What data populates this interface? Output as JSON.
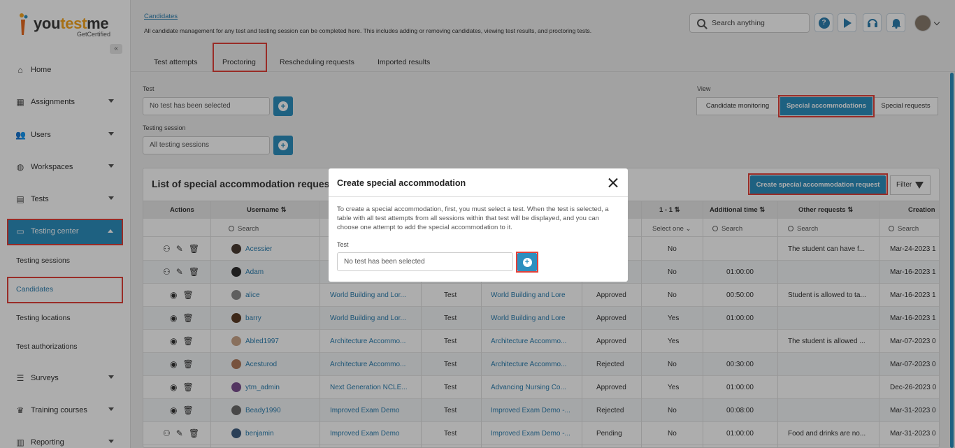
{
  "app": {
    "logo_text_a": "you",
    "logo_text_b": "test",
    "logo_text_c": "me",
    "logo_tagline": "GetCertified"
  },
  "sidebar": {
    "items": [
      {
        "label": "Home",
        "icon": "home-icon"
      },
      {
        "label": "Assignments",
        "icon": "grid-icon"
      },
      {
        "label": "Users",
        "icon": "users-icon"
      },
      {
        "label": "Workspaces",
        "icon": "globe-icon"
      },
      {
        "label": "Tests",
        "icon": "file-icon"
      },
      {
        "label": "Testing center",
        "icon": "monitor-icon"
      },
      {
        "label": "Surveys",
        "icon": "list-icon"
      },
      {
        "label": "Training courses",
        "icon": "trophy-icon"
      },
      {
        "label": "Reporting",
        "icon": "chart-icon"
      }
    ],
    "subitems": [
      "Testing sessions",
      "Candidates",
      "Testing locations",
      "Test authorizations"
    ]
  },
  "header": {
    "breadcrumb": "Candidates",
    "description": "All candidate management for any test and testing session can be completed here. This includes adding or removing candidates, viewing test results, and proctoring tests.",
    "search_placeholder": "Search anything",
    "help": "?"
  },
  "tabs": [
    "Test attempts",
    "Proctoring",
    "Rescheduling requests",
    "Imported results"
  ],
  "filters": {
    "test_label": "Test",
    "test_value": "No test has been selected",
    "session_label": "Testing session",
    "session_value": "All testing sessions",
    "view_label": "View",
    "views": [
      "Candidate monitoring",
      "Special accommodations",
      "Special requests"
    ]
  },
  "panel": {
    "title": "List of special accommodation requests",
    "create_button": "Create special accommodation request",
    "filter_button": "Filter",
    "columns": {
      "actions": "Actions",
      "username": "Username ⇅",
      "one_to_one": "1 - 1 ⇅",
      "additional_time": "Additional time ⇅",
      "other_requests": "Other requests ⇅",
      "creation": "Creation"
    },
    "search": "Search",
    "select_one": "Select one",
    "rows": [
      {
        "user": "Acessier",
        "test": "",
        "type": "",
        "session": "",
        "status": "",
        "one": "No",
        "time": "",
        "other": "The student can have f...",
        "created": "Mar-24-2023 1"
      },
      {
        "user": "Adam",
        "test": "",
        "type": "",
        "session": "",
        "status": "",
        "one": "No",
        "time": "01:00:00",
        "other": "",
        "created": "Mar-16-2023 1"
      },
      {
        "user": "alice",
        "test": "World Building and Lor...",
        "type": "Test",
        "session": "World Building and Lore",
        "status": "Approved",
        "one": "No",
        "time": "00:50:00",
        "other": "Student is allowed to ta...",
        "created": "Mar-16-2023 1"
      },
      {
        "user": "barry",
        "test": "World Building and Lor...",
        "type": "Test",
        "session": "World Building and Lore",
        "status": "Approved",
        "one": "Yes",
        "time": "01:00:00",
        "other": "",
        "created": "Mar-16-2023 1"
      },
      {
        "user": "Abled1997",
        "test": "Architecture Accommo...",
        "type": "Test",
        "session": "Architecture Accommo...",
        "status": "Approved",
        "one": "Yes",
        "time": "",
        "other": "The student is allowed ...",
        "created": "Mar-07-2023 0"
      },
      {
        "user": "Acesturod",
        "test": "Architecture Accommo...",
        "type": "Test",
        "session": "Architecture Accommo...",
        "status": "Rejected",
        "one": "No",
        "time": "00:30:00",
        "other": "",
        "created": "Mar-07-2023 0"
      },
      {
        "user": "ytm_admin",
        "test": "Next Generation NCLE...",
        "type": "Test",
        "session": "Advancing Nursing Co...",
        "status": "Approved",
        "one": "Yes",
        "time": "01:00:00",
        "other": "",
        "created": "Dec-26-2023 0"
      },
      {
        "user": "Beady1990",
        "test": "Improved Exam Demo",
        "type": "Test",
        "session": "Improved Exam Demo -...",
        "status": "Rejected",
        "one": "No",
        "time": "00:08:00",
        "other": "",
        "created": "Mar-31-2023 0"
      },
      {
        "user": "benjamin",
        "test": "Improved Exam Demo",
        "type": "Test",
        "session": "Improved Exam Demo -...",
        "status": "Pending",
        "one": "No",
        "time": "01:00:00",
        "other": "Food and drinks are no...",
        "created": "Mar-31-2023 0"
      }
    ]
  },
  "modal": {
    "title": "Create special accommodation",
    "text": "To create a special accommodation, first, you must select a test. When the test is selected, a table with all test attempts from all sessions within that test will be displayed, and you can choose one attempt to add the special accommodation to it.",
    "test_label": "Test",
    "test_value": "No test has been selected"
  },
  "colors": {
    "accent": "#2d8fbf",
    "highlight": "#e2413a",
    "brand_orange": "#f5a623"
  }
}
